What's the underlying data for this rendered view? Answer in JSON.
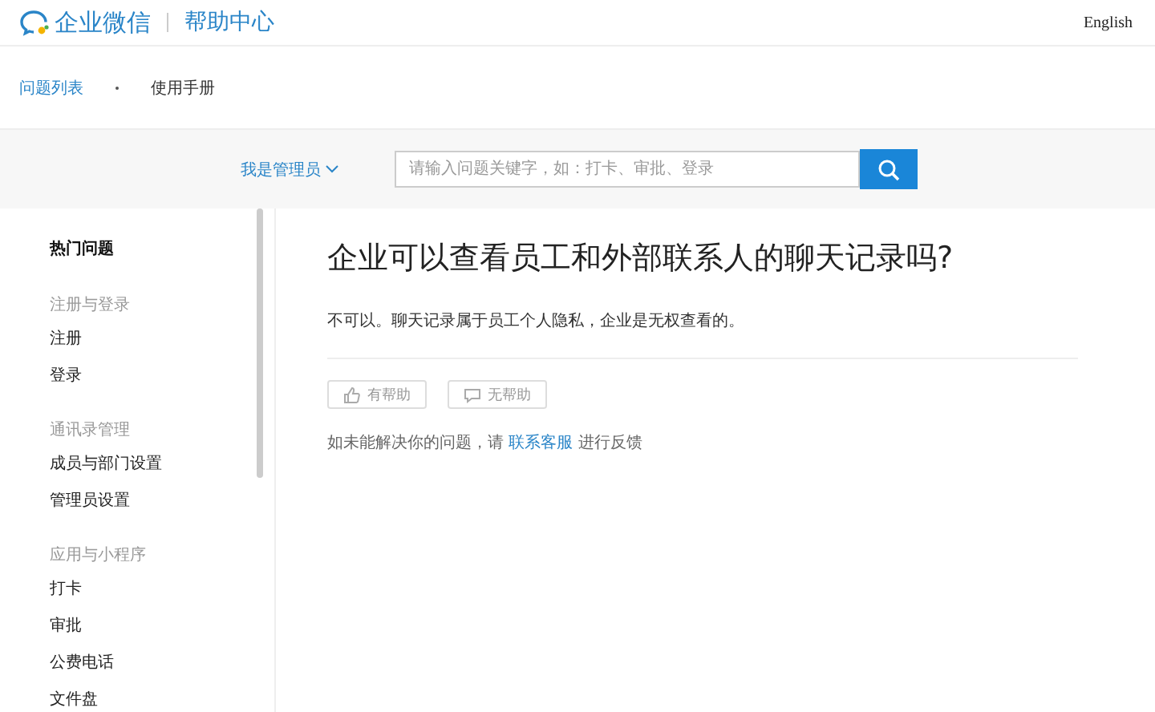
{
  "header": {
    "logo_text": "企业微信",
    "section": "帮助中心",
    "language_link": "English"
  },
  "breadcrumb": [
    {
      "label": "问题列表",
      "kind": "link"
    },
    {
      "label": "使用手册",
      "kind": "current"
    }
  ],
  "search": {
    "role_selector": "我是管理员",
    "placeholder": "请输入问题关键字，如：打卡、审批、登录"
  },
  "sidebar": {
    "items": [
      {
        "label": "热门问题",
        "kind": "top"
      },
      {
        "label": "注册与登录",
        "kind": "group"
      },
      {
        "label": "注册",
        "kind": "item"
      },
      {
        "label": "登录",
        "kind": "item"
      },
      {
        "label": "通讯录管理",
        "kind": "group"
      },
      {
        "label": "成员与部门设置",
        "kind": "item"
      },
      {
        "label": "管理员设置",
        "kind": "item"
      },
      {
        "label": "应用与小程序",
        "kind": "group"
      },
      {
        "label": "打卡",
        "kind": "item"
      },
      {
        "label": "审批",
        "kind": "item"
      },
      {
        "label": "公费电话",
        "kind": "item"
      },
      {
        "label": "文件盘",
        "kind": "item"
      }
    ]
  },
  "article": {
    "title": "企业可以查看员工和外部联系人的聊天记录吗?",
    "answer": "不可以。聊天记录属于员工个人隐私，企业是无权查看的。",
    "feedback_buttons": [
      {
        "label": "有帮助",
        "kind": "like"
      },
      {
        "label": "无帮助",
        "kind": "comment"
      }
    ],
    "contact_prefix": "如未能解决你的问题，请",
    "contact_link": "联系客服",
    "contact_suffix": "进行反馈"
  }
}
